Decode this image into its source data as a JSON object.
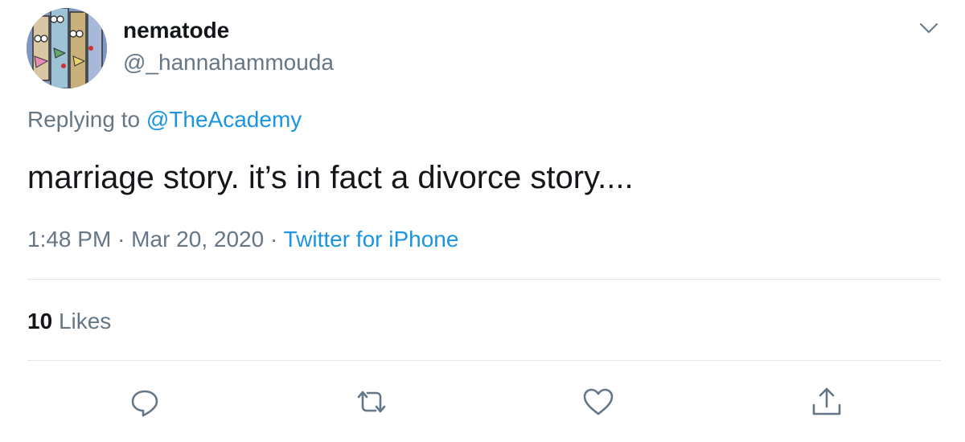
{
  "tweet": {
    "display_name": "nematode",
    "handle": "@_hannahammouda",
    "replying_prefix": "Replying to",
    "replying_to": "@TheAcademy",
    "text": "marriage story. it’s in fact a divorce story....",
    "time": "1:48 PM",
    "date": "Mar 20, 2020",
    "separator": "·",
    "source": "Twitter for iPhone",
    "likes_count": "10",
    "likes_label": "Likes"
  },
  "icons": {
    "menu": "chevron-down-icon",
    "reply": "reply-icon",
    "retweet": "retweet-icon",
    "like": "heart-icon",
    "share": "share-icon"
  },
  "colors": {
    "link": "#1b95e0",
    "secondary_text": "#657786",
    "primary_text": "#14171a",
    "divider": "#e1e8ed"
  }
}
